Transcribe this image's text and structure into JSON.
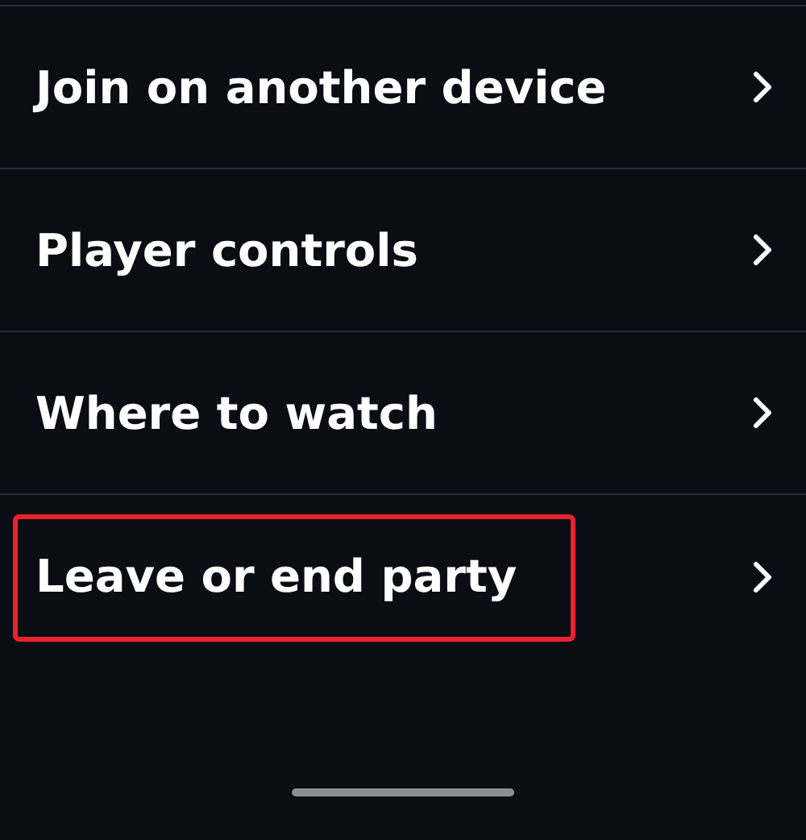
{
  "menu": {
    "items": [
      {
        "label": "Join on another device",
        "highlighted": false
      },
      {
        "label": "Player controls",
        "highlighted": false
      },
      {
        "label": "Where to watch",
        "highlighted": false
      },
      {
        "label": "Leave or end party",
        "highlighted": true
      }
    ]
  }
}
